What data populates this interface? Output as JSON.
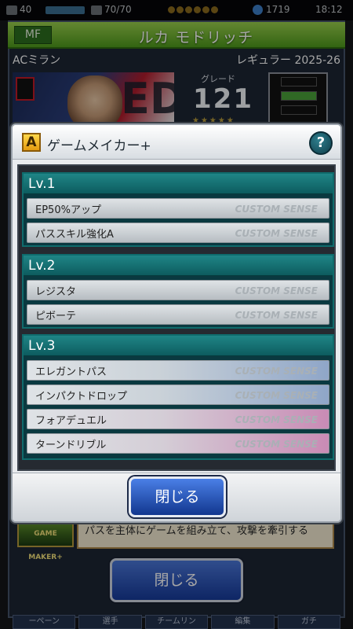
{
  "status_bar": {
    "level": "40",
    "stamina": "70/70",
    "currency": "1719",
    "time": "18:12"
  },
  "player": {
    "position": "MF",
    "name": "ルカ モドリッチ",
    "club": "ACミラン",
    "card_type": "レギュラー 2025-26",
    "grade_label": "グレード",
    "grade_value": "121",
    "stars": "★★★★★"
  },
  "back_screen": {
    "skill_icon_text": "GAME MAKER+",
    "skill_description": "パスを主体にゲームを組み立て、攻撃を牽引する",
    "close_label": "閉じる",
    "tabs": [
      "ーペーン",
      "選手",
      "チームリン",
      "編集",
      "ガチ"
    ]
  },
  "modal": {
    "rank": "A",
    "title": "ゲームメイカー+",
    "help_label": "?",
    "close_label": "閉じる",
    "levels": [
      {
        "label": "Lv.1",
        "skills": [
          {
            "name": "EP50%アップ",
            "tag": "CUSTOM SENSE"
          },
          {
            "name": "パススキル強化A",
            "tag": "CUSTOM SENSE"
          }
        ]
      },
      {
        "label": "Lv.2",
        "skills": [
          {
            "name": "レジスタ",
            "tag": "CUSTOM SENSE"
          },
          {
            "name": "ピボーテ",
            "tag": "CUSTOM SENSE"
          }
        ]
      },
      {
        "label": "Lv.3",
        "skills": [
          {
            "name": "エレガントパス",
            "tag": "CUSTOM SENSE"
          },
          {
            "name": "インパクトドロップ",
            "tag": "CUSTOM SENSE"
          },
          {
            "name": "フォアデュエル",
            "tag": "CUSTOM SENSE"
          },
          {
            "name": "ターンドリブル",
            "tag": "CUSTOM SENSE"
          }
        ]
      }
    ]
  },
  "colors": {
    "title_bar": "#6fb22d",
    "level_header": "#137072",
    "close_button": "#2a5ac0"
  }
}
